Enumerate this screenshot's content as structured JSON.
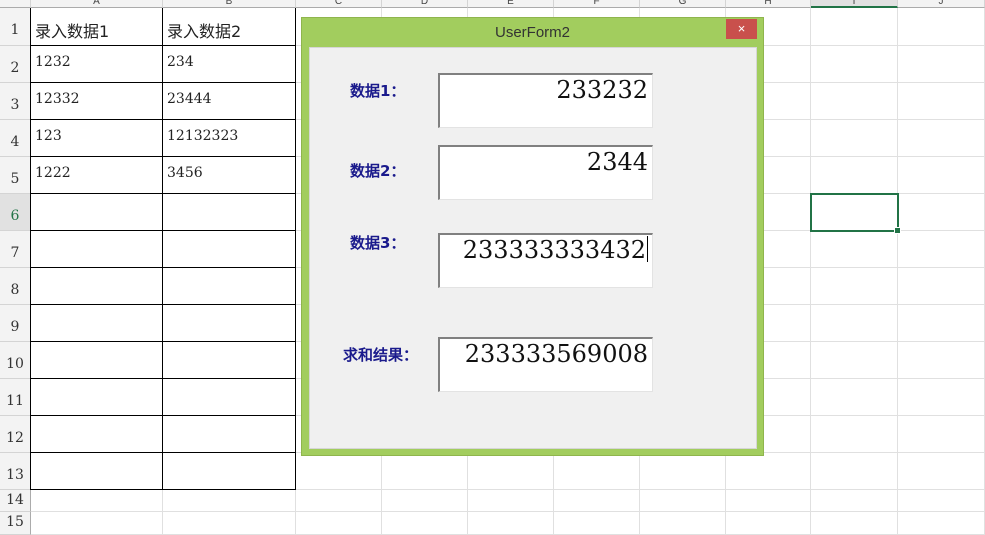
{
  "sheet": {
    "columns": [
      "A",
      "B",
      "C",
      "D",
      "E",
      "F",
      "G",
      "H",
      "I",
      "J"
    ],
    "rows": [
      "1",
      "2",
      "3",
      "4",
      "5",
      "6",
      "7",
      "8",
      "9",
      "10",
      "11",
      "12",
      "13",
      "14",
      "15"
    ],
    "selected_cell": "I6",
    "table": {
      "headers": [
        "录入数据1",
        "录入数据2"
      ],
      "data": [
        [
          "1232",
          "234"
        ],
        [
          "12332",
          "23444"
        ],
        [
          "123",
          "12132323"
        ],
        [
          "1222",
          "3456"
        ]
      ]
    }
  },
  "dialog": {
    "title": "UserForm2",
    "close_label": "×",
    "fields": [
      {
        "label": "数据1：",
        "value": "233232"
      },
      {
        "label": "数据2：",
        "value": "2344"
      },
      {
        "label": "数据3：",
        "value": "233333333432"
      },
      {
        "label": "求和结果：",
        "value": "233333569008"
      }
    ]
  }
}
